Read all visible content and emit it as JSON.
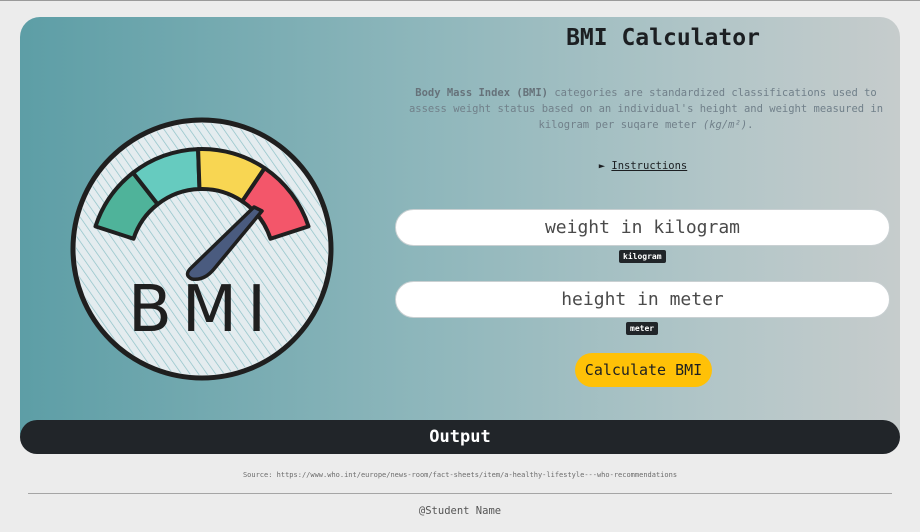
{
  "app": {
    "title": "BMI Calculator",
    "description_bold": "Body Mass Index (BMI)",
    "description_text": " categories are standardized classifications used to assess weight status based on an individual's height and weight measured in kilogram per suqare meter ",
    "description_unit": "(kg/m²)",
    "description_end": "."
  },
  "instructions": {
    "marker": "►",
    "label": "Instructions"
  },
  "form": {
    "weight_placeholder": "weight in kilogram",
    "weight_unit": "kilogram",
    "height_placeholder": "height in meter",
    "height_unit": "meter",
    "calculate_label": "Calculate BMI"
  },
  "output": {
    "label": "Output"
  },
  "logo": {
    "text": "BMI",
    "gauge_colors": [
      "#4fb39a",
      "#66cbbf",
      "#f8d652",
      "#f3566a"
    ],
    "needle_color": "#4a5b7f"
  },
  "source": "Source: https://www.who.int/europe/news-room/fact-sheets/item/a-healthy-lifestyle---who-recommendations",
  "footer": "@Student Name",
  "colors": {
    "accent": "#ffc107",
    "dark": "#212529"
  }
}
